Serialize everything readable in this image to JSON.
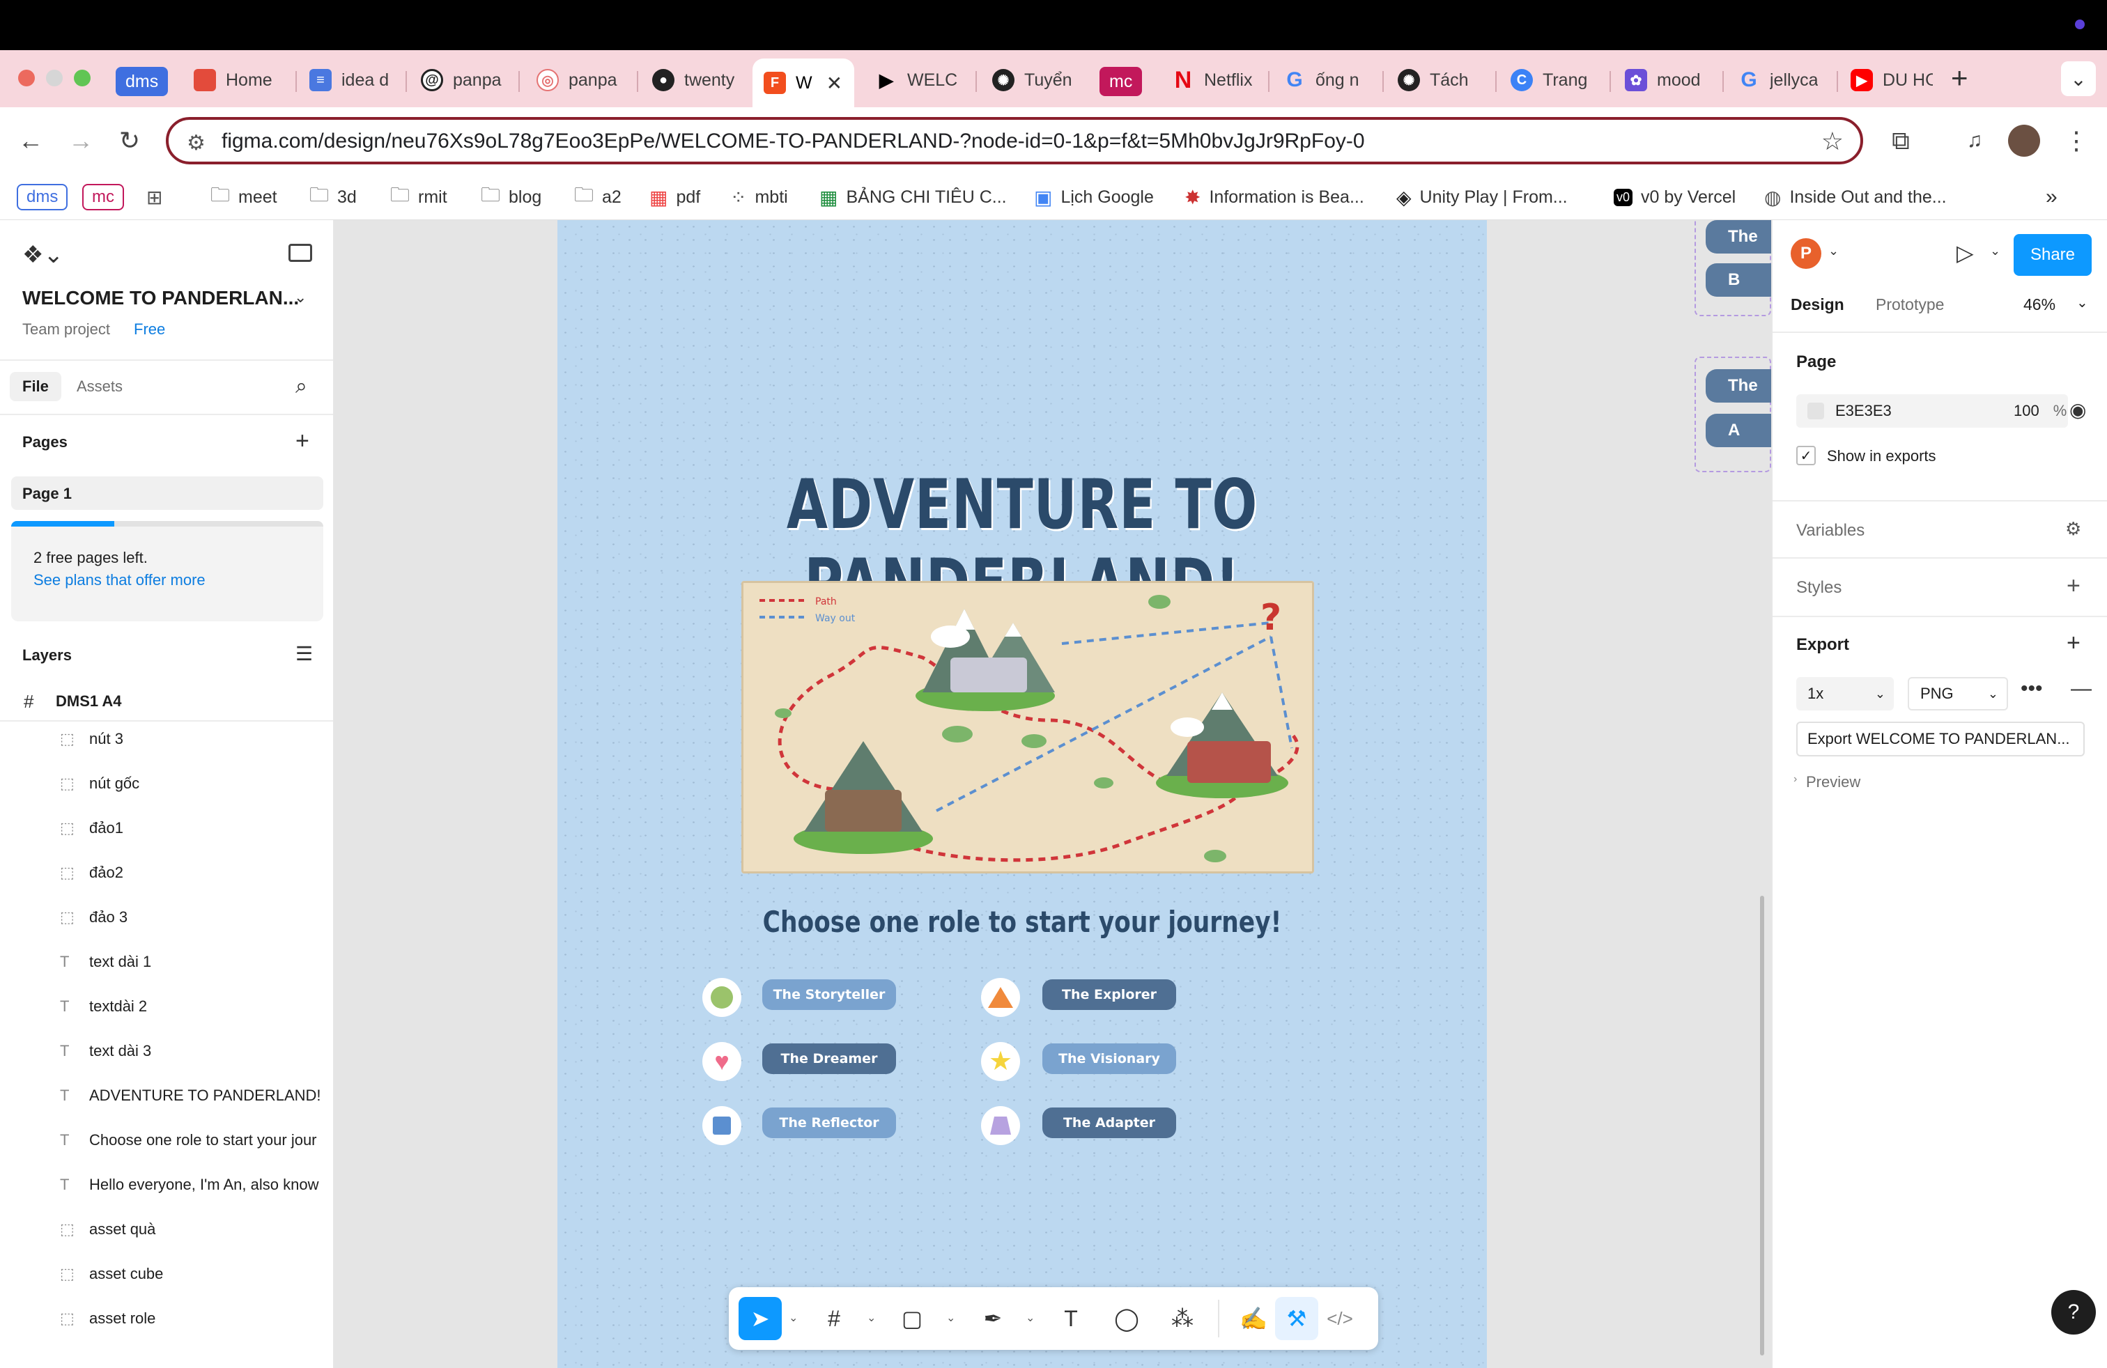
{
  "browser": {
    "tabs": [
      {
        "label": "dms",
        "kind": "group",
        "color": "#3f6fe0"
      },
      {
        "label": "Home",
        "color": "#e34b3b",
        "icon": "rounded-square-icon"
      },
      {
        "label": "idea d",
        "color": "#4a78e0",
        "icon": "docs-icon"
      },
      {
        "label": "panpa",
        "color": "#222",
        "icon": "threads-icon"
      },
      {
        "label": "panpa",
        "color": "#e57373",
        "icon": "spiral-icon"
      },
      {
        "label": "twenty",
        "color": "#222",
        "icon": "github-icon"
      },
      {
        "label": "W",
        "color": "#f24e1e",
        "icon": "figma-icon",
        "active": true
      },
      {
        "label": "WELC",
        "color": "#000",
        "icon": "play-icon"
      },
      {
        "label": "Tuyển",
        "color": "#222",
        "icon": "openai-icon"
      },
      {
        "label": "mc",
        "kind": "group",
        "color": "#c2185b"
      },
      {
        "label": "Netflix",
        "color": "#e50914",
        "icon": "netflix-icon"
      },
      {
        "label": "ống n",
        "color": "#4285f4",
        "icon": "google-icon"
      },
      {
        "label": "Tách",
        "color": "#222",
        "icon": "openai-icon"
      },
      {
        "label": "Trang",
        "color": "#3b82f6",
        "icon": "c-icon"
      },
      {
        "label": "mood",
        "color": "#6b4fd8",
        "icon": "gear-icon"
      },
      {
        "label": "jellyca",
        "color": "#4285f4",
        "icon": "google-icon"
      },
      {
        "label": "DU HO",
        "color": "#ff0000",
        "icon": "youtube-icon"
      }
    ],
    "url": "figma.com/design/neu76Xs9oL78g7Eoo3EpPe/WELCOME-TO-PANDERLAND-?node-id=0-1&p=f&t=5Mh0bvJgJr9RpFoy-0",
    "bookmarks": [
      {
        "label": "dms",
        "kind": "pill"
      },
      {
        "label": "mc",
        "kind": "pill"
      },
      {
        "label": "meet"
      },
      {
        "label": "3d"
      },
      {
        "label": "rmit"
      },
      {
        "label": "blog"
      },
      {
        "label": "a2"
      },
      {
        "label": "pdf"
      },
      {
        "label": "mbti"
      },
      {
        "label": "BẢNG CHI TIÊU C..."
      },
      {
        "label": "Lịch Google"
      },
      {
        "label": "Information is Bea..."
      },
      {
        "label": "Unity Play | From..."
      },
      {
        "label": "v0 by Vercel"
      },
      {
        "label": "Inside Out and the..."
      }
    ]
  },
  "left": {
    "file_title": "WELCOME TO PANDERLAN...",
    "team": "Team project",
    "plan": "Free",
    "tabs": [
      "File",
      "Assets"
    ],
    "pages_title": "Pages",
    "page1": "Page 1",
    "free_pages": "2 free pages left.",
    "see_plans": "See plans that offer more",
    "free_pages_progress": 0.33,
    "layers_title": "Layers",
    "root_layer": "DMS1 A4",
    "layers": [
      {
        "name": "nút 3",
        "type": "frame"
      },
      {
        "name": "nút gốc",
        "type": "frame"
      },
      {
        "name": "đảo1",
        "type": "frame"
      },
      {
        "name": "đảo2",
        "type": "frame"
      },
      {
        "name": "đảo 3",
        "type": "frame"
      },
      {
        "name": "text dài 1",
        "type": "text"
      },
      {
        "name": "textdài 2",
        "type": "text"
      },
      {
        "name": "text dài 3",
        "type": "text"
      },
      {
        "name": "ADVENTURE TO PANDERLAND!",
        "type": "text"
      },
      {
        "name": "Choose one role to start your jour",
        "type": "text"
      },
      {
        "name": "Hello everyone, I'm An, also know",
        "type": "text"
      },
      {
        "name": "asset quà",
        "type": "frame"
      },
      {
        "name": "asset cube",
        "type": "frame"
      },
      {
        "name": "asset role",
        "type": "frame"
      }
    ]
  },
  "canvas": {
    "title": "ADVENTURE TO PANDERLAND!",
    "subtitle": "Choose one role to start your journey!",
    "map_legend": [
      "Path",
      "Way out"
    ],
    "roles": [
      {
        "label": "The Storyteller",
        "marker": "circle-icon",
        "marker_color": "#9bc36b",
        "btn_color": "#7aa3cf"
      },
      {
        "label": "The Explorer",
        "marker": "triangle-icon",
        "marker_color": "#f08a3c",
        "btn_color": "#4f6f93"
      },
      {
        "label": "The Dreamer",
        "marker": "heart-icon",
        "marker_color": "#ef6b8a",
        "btn_color": "#4f6f93"
      },
      {
        "label": "The Visionary",
        "marker": "star-icon",
        "marker_color": "#f5d43c",
        "btn_color": "#7aa3cf"
      },
      {
        "label": "The Reflector",
        "marker": "square-icon",
        "marker_color": "#5b8fd0",
        "btn_color": "#7aa3cf"
      },
      {
        "label": "The Adapter",
        "marker": "trapezoid-icon",
        "marker_color": "#b7a2e0",
        "btn_color": "#4f6f93"
      }
    ],
    "side_pills": [
      "The",
      "B",
      "The",
      "A"
    ]
  },
  "right": {
    "avatar_letter": "P",
    "share": "Share",
    "tabs": [
      "Design",
      "Prototype"
    ],
    "zoom": "46%",
    "page_title": "Page",
    "page_color": "E3E3E3",
    "page_opacity": "100",
    "percent": "%",
    "show_in_exports": "Show in exports",
    "variables": "Variables",
    "styles": "Styles",
    "export_title": "Export",
    "export_scale": "1x",
    "export_format": "PNG",
    "export_button": "Export WELCOME TO PANDERLAN...",
    "preview": "Preview",
    "help": "?"
  }
}
